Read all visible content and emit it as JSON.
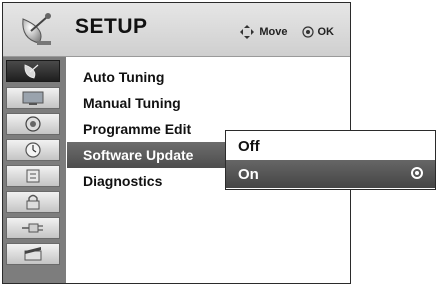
{
  "header": {
    "title": "SETUP",
    "move_label": "Move",
    "ok_label": "OK",
    "icon": "satellite-dish-icon"
  },
  "sidebar": {
    "items": [
      {
        "icon": "satellite-dish-icon",
        "active": true
      },
      {
        "icon": "tv-picture-icon",
        "active": false
      },
      {
        "icon": "speaker-icon",
        "active": false
      },
      {
        "icon": "clock-icon",
        "active": false
      },
      {
        "icon": "options-icon",
        "active": false
      },
      {
        "icon": "lock-icon",
        "active": false
      },
      {
        "icon": "input-plug-icon",
        "active": false
      },
      {
        "icon": "usb-movie-icon",
        "active": false
      }
    ]
  },
  "menu": {
    "items": [
      {
        "label": "Auto Tuning"
      },
      {
        "label": "Manual Tuning"
      },
      {
        "label": "Programme Edit"
      },
      {
        "label": "Software Update"
      },
      {
        "label": "Diagnostics"
      }
    ],
    "selected_index": 3
  },
  "submenu": {
    "items": [
      {
        "label": "Off"
      },
      {
        "label": "On"
      }
    ],
    "selected_index": 1
  },
  "colors": {
    "highlight": "#555555",
    "sidebar": "#7d7d7d"
  }
}
